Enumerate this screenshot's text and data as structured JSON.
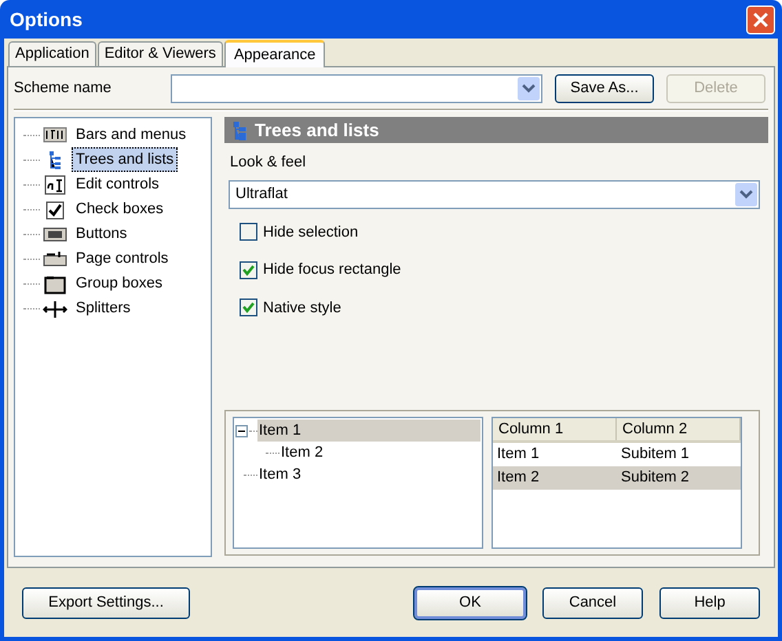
{
  "window": {
    "title": "Options"
  },
  "tabs": [
    {
      "label": "Application",
      "selected": false
    },
    {
      "label": "Editor & Viewers",
      "selected": false
    },
    {
      "label": "Appearance",
      "selected": true
    }
  ],
  "scheme": {
    "label": "Scheme name",
    "buttons": [
      {
        "label": "Save As...",
        "disabled": false
      },
      {
        "label": "Delete",
        "disabled": true
      }
    ]
  },
  "categories": [
    {
      "label": "Bars and menus",
      "selected": false
    },
    {
      "label": "Trees and lists",
      "selected": true
    },
    {
      "label": "Edit controls",
      "selected": false
    },
    {
      "label": "Check boxes",
      "selected": false
    },
    {
      "label": "Buttons",
      "selected": false
    },
    {
      "label": "Page controls",
      "selected": false
    },
    {
      "label": "Group boxes",
      "selected": false
    },
    {
      "label": "Splitters",
      "selected": false
    }
  ],
  "section": {
    "title": "Trees and lists",
    "look_label": "Look & feel",
    "look_value": "Ultraflat",
    "options": [
      {
        "label": "Hide selection",
        "checked": false
      },
      {
        "label": "Hide focus rectangle",
        "checked": true
      },
      {
        "label": "Native style",
        "checked": true
      }
    ]
  },
  "preview": {
    "tree": [
      {
        "label": "Item 1",
        "selected": true,
        "expanded": true,
        "children": [
          {
            "label": "Item 2",
            "selected": false
          }
        ]
      },
      {
        "label": "Item 3",
        "selected": false
      }
    ],
    "list": {
      "columns": [
        "Column 1",
        "Column 2"
      ],
      "rows": [
        {
          "cells": [
            "Item 1",
            "Subitem 1"
          ],
          "selected": false
        },
        {
          "cells": [
            "Item 2",
            "Subitem 2"
          ],
          "selected": true
        }
      ]
    }
  },
  "footer": [
    {
      "label": "Export Settings...",
      "default": false
    },
    {
      "label": "OK",
      "default": true
    },
    {
      "label": "Cancel",
      "default": false
    },
    {
      "label": "Help",
      "default": false
    }
  ]
}
